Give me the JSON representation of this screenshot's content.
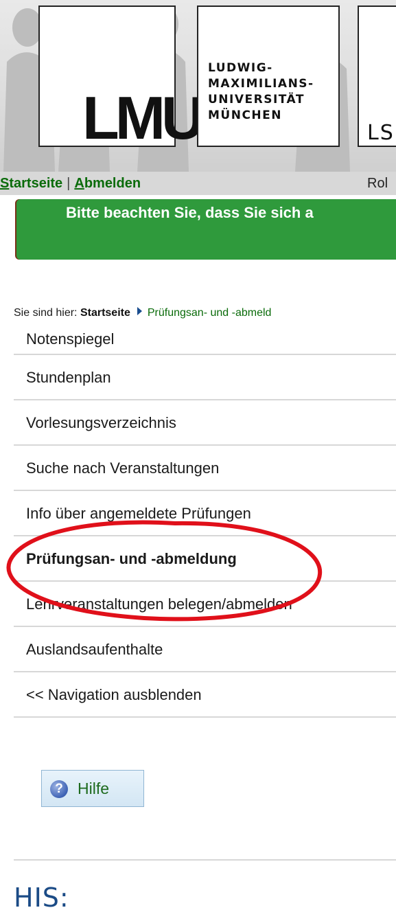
{
  "header": {
    "lmu_logo_text": "LMU",
    "university_name": [
      "LUDWIG-",
      "MAXIMILIANS-",
      "UNIVERSITÄT",
      "MÜNCHEN"
    ],
    "lsf_logo_text": "LS"
  },
  "topnav": {
    "home_label_first": "S",
    "home_label_rest": "tartseite",
    "separator": "|",
    "logout_label_first": "A",
    "logout_label_rest": "bmelden",
    "role_text": "Rol"
  },
  "notice": {
    "text": "Bitte beachten Sie, dass Sie sich a",
    "color": "#2f9a3c"
  },
  "breadcrumb": {
    "prefix": "Sie sind hier: ",
    "home": "Startseite",
    "current": "Prüfungsan- und -abmeld"
  },
  "nav": {
    "items": [
      {
        "label": "Notenspiegel"
      },
      {
        "label": "Stundenplan"
      },
      {
        "label": "Vorlesungsverzeichnis"
      },
      {
        "label": "Suche nach Veranstaltungen"
      },
      {
        "label": "Info über angemeldete Prüfungen"
      },
      {
        "label": "Prüfungsan- und -abmeldung",
        "active": true
      },
      {
        "label": "Lehrveranstaltungen belegen/abmelden"
      },
      {
        "label": "Auslandsaufenthalte"
      },
      {
        "label": "<< Navigation ausblenden"
      }
    ]
  },
  "help": {
    "label": "Hilfe",
    "icon": "question-mark-icon"
  },
  "footer": {
    "logo_text": "HIS:"
  },
  "colors": {
    "link_green": "#0a6b0a",
    "annotation_red": "#e0101a",
    "his_blue": "#1b4b86"
  }
}
